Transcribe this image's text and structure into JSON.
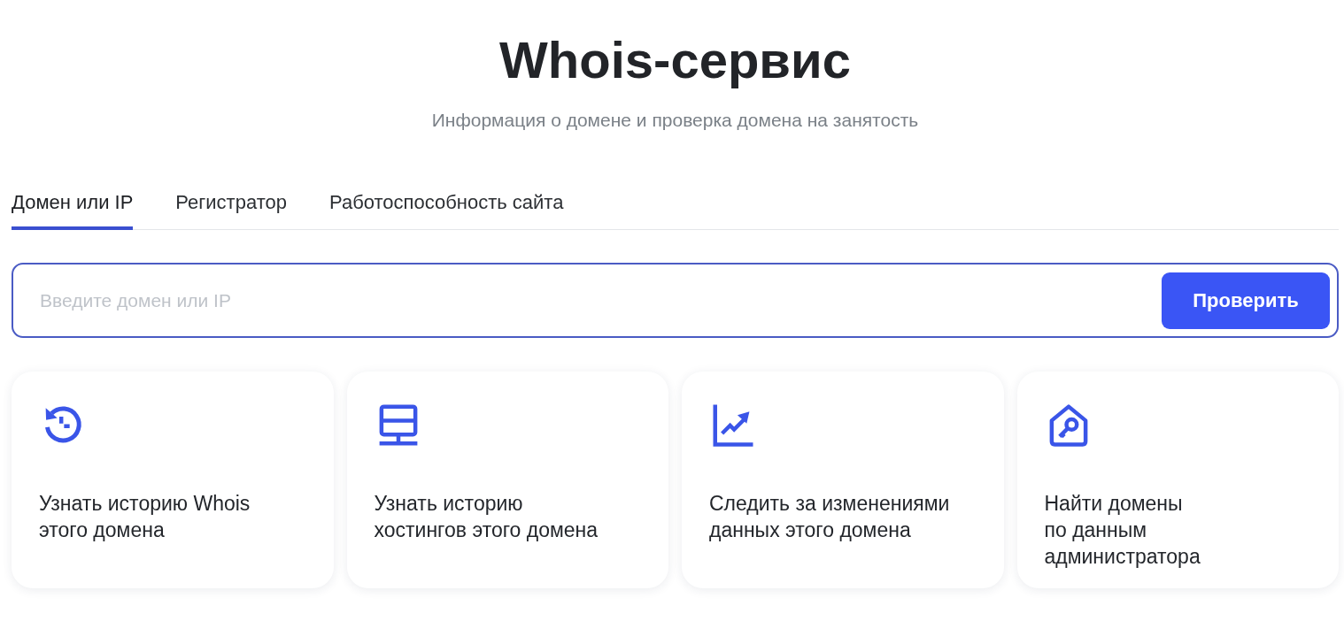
{
  "header": {
    "title": "Whois-сервис",
    "subtitle": "Информация о домене и проверка домена на занятость"
  },
  "tabs": [
    {
      "label": "Домен или IP",
      "selected": true
    },
    {
      "label": "Регистратор",
      "selected": false
    },
    {
      "label": "Работоспособность сайта",
      "selected": false
    }
  ],
  "search": {
    "placeholder": "Введите домен или IP",
    "button": "Проверить"
  },
  "cards": [
    {
      "kind": "history",
      "text": "Узнать историю Whois\nэтого домена"
    },
    {
      "kind": "server",
      "text": "Узнать историю\nхостингов этого домена"
    },
    {
      "kind": "chart",
      "text": "Следить за изменениями\nданных этого домена"
    },
    {
      "kind": "house-key",
      "text": "Найти домены\nпо данным\nадминистратора"
    }
  ]
}
